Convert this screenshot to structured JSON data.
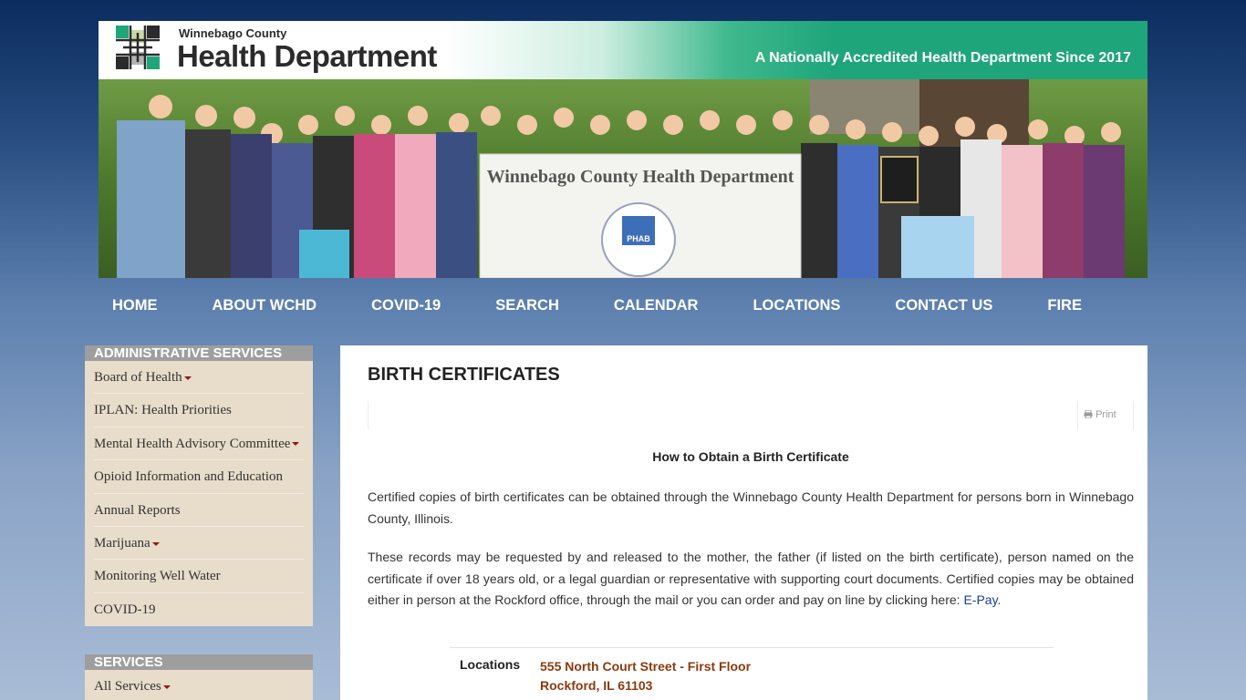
{
  "header": {
    "org_top": "Winnebago County",
    "org_main": "Health Department",
    "tagline": "A Nationally Accredited Health Department Since 2017"
  },
  "photo": {
    "banner_text": "Winnebago County Health Department",
    "seal_text": "PHAB"
  },
  "nav": {
    "items": [
      "HOME",
      "ABOUT WCHD",
      "COVID-19",
      "SEARCH",
      "CALENDAR",
      "LOCATIONS",
      "CONTACT US",
      "FIRE"
    ]
  },
  "sidebar": {
    "admin_title": "ADMINISTRATIVE SERVICES",
    "admin_items": [
      {
        "label": "Board of Health"
      },
      {
        "label": "IPLAN: Health Priorities"
      },
      {
        "label": "Mental Health Advisory Committee"
      },
      {
        "label": "Opioid Information and Education"
      },
      {
        "label": "Annual Reports"
      },
      {
        "label": "Marijuana"
      },
      {
        "label": "Monitoring Well Water"
      },
      {
        "label": "COVID-19"
      }
    ],
    "services_title": "SERVICES",
    "services_items": [
      {
        "label": "All Services"
      }
    ]
  },
  "content": {
    "title": "BIRTH CERTIFICATES",
    "print_label": "Print",
    "subheading": "How to Obtain a Birth Certificate",
    "para1": "Certified copies of birth certificates can be obtained through the Winnebago County Health Department for persons born in Winnebago County, Illinois.",
    "para2": "These records may be requested by and released to the mother, the father (if listed on the birth certificate), person named on the certificate if over 18 years old, or a legal guardian or representative with supporting court documents.  Certified copies may be obtained either in person at the Rockford office, through the mail or you can order and pay on line by clicking here: ",
    "epay_link": "E-Pay",
    "para2_end": ".",
    "locations_label": "Locations",
    "address_line1": "555 North Court Street - First Floor",
    "address_line2": "Rockford, IL 61103"
  }
}
